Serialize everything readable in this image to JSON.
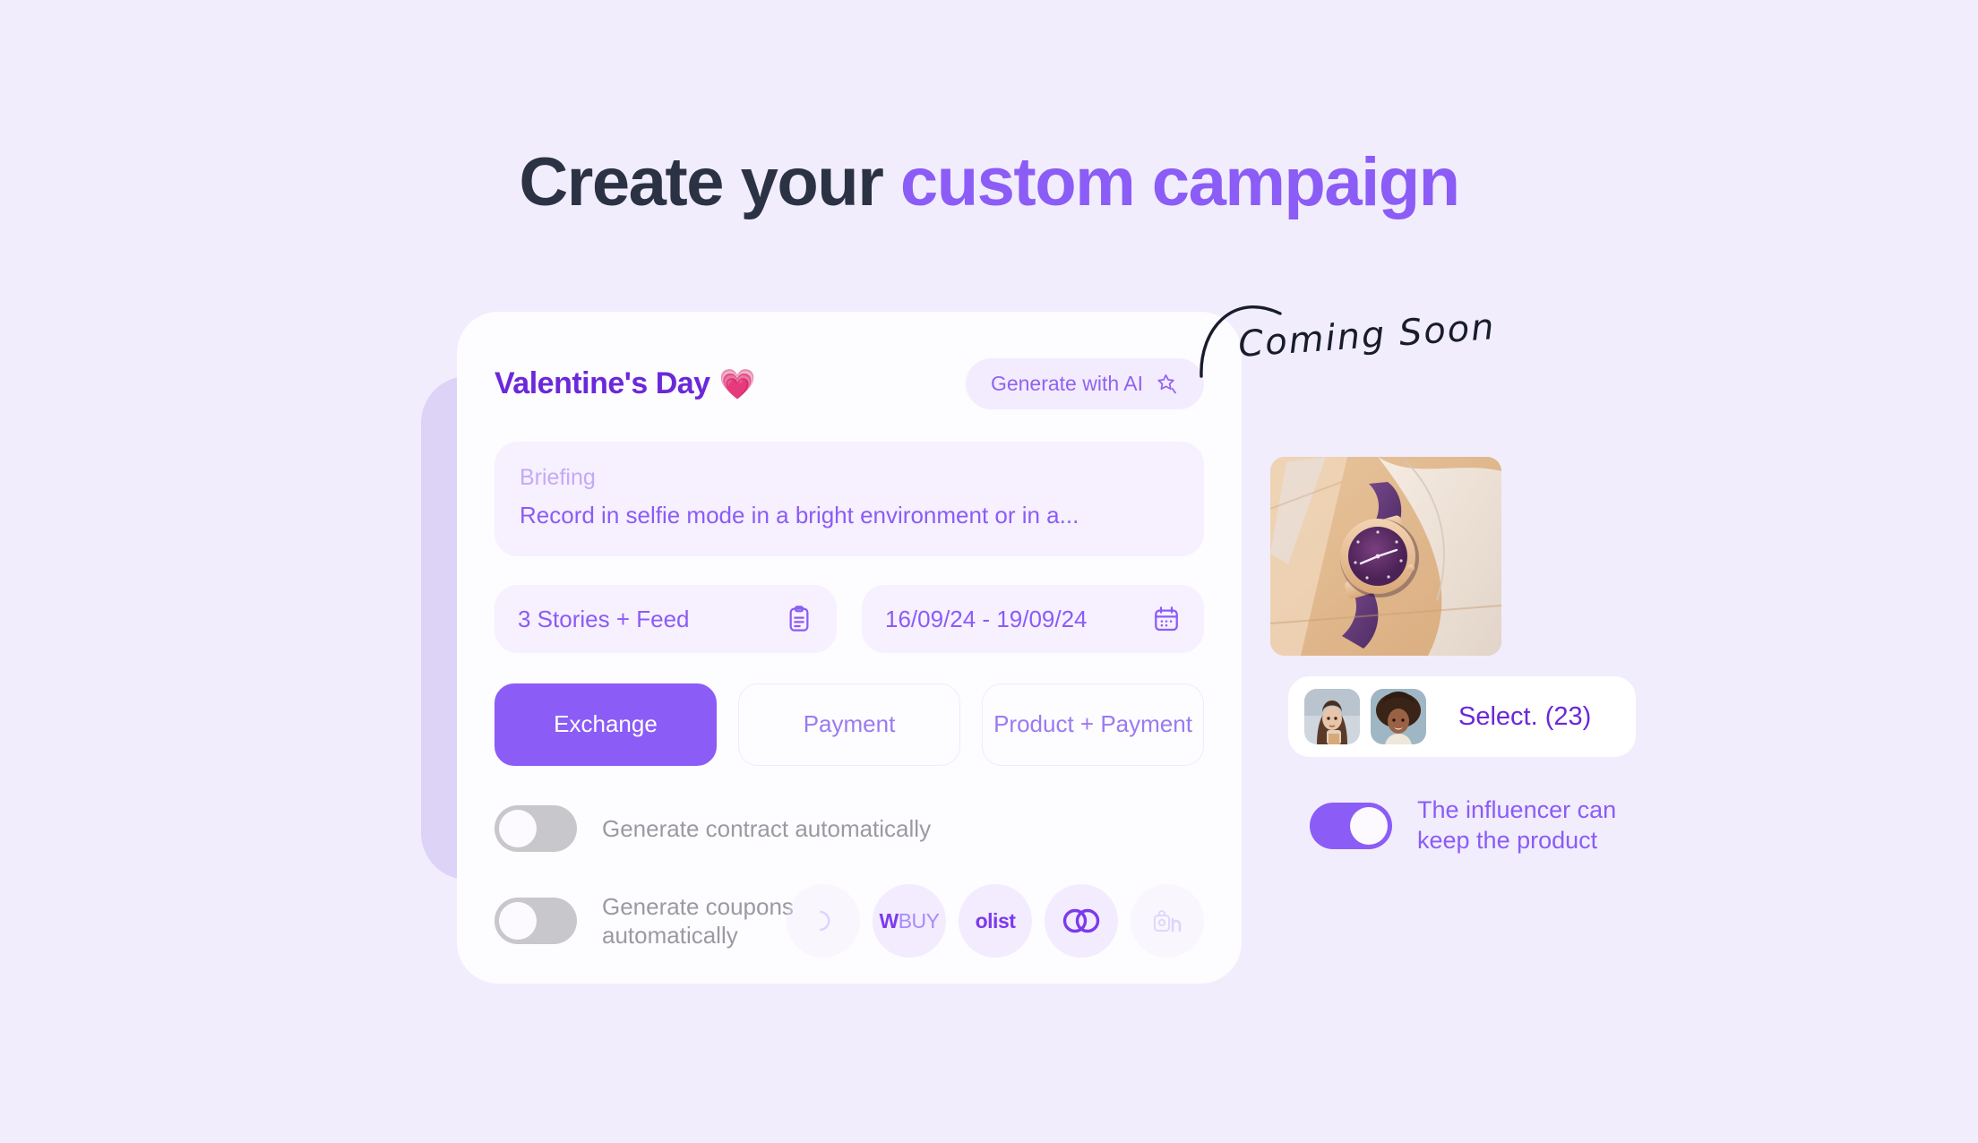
{
  "headline": {
    "lead": "Create your ",
    "accent": "custom campaign"
  },
  "card": {
    "title": "Valentine's Day",
    "title_emoji": "💗",
    "ai_button": {
      "label": "Generate with AI",
      "icon": "sparkle-star-icon"
    },
    "briefing": {
      "label": "Briefing",
      "text": "Record in selfie mode in a bright environment or in a..."
    },
    "fields": [
      {
        "value": "3 Stories + Feed",
        "icon": "clipboard-icon"
      },
      {
        "value": "16/09/24 - 19/09/24",
        "icon": "calendar-icon"
      }
    ],
    "tabs": [
      {
        "label": "Exchange",
        "active": true
      },
      {
        "label": "Payment",
        "active": false
      },
      {
        "label": "Product + Payment",
        "active": false
      }
    ],
    "switches": [
      {
        "label": "Generate contract automatically",
        "on": false
      },
      {
        "label": "Generate coupons automatically",
        "on": false
      }
    ],
    "logos": [
      {
        "name": "partner-logo-faded-left",
        "text": "",
        "faded": true
      },
      {
        "name": "wbuy-logo",
        "text_bold": "W",
        "text_thin": "BUY",
        "faded": false
      },
      {
        "name": "olist-logo",
        "text": "olist",
        "faded": false
      },
      {
        "name": "loop-logo",
        "text": "",
        "faded": false
      },
      {
        "name": "bagy-logo-faded-right",
        "text": "",
        "faded": true
      }
    ]
  },
  "annotation": {
    "coming_soon": "Coming Soon"
  },
  "right_panel": {
    "product_image_alt": "purple-leather-wristwatch",
    "select": {
      "label": "Select. (23)",
      "avatars": [
        "influencer-avatar-1",
        "influencer-avatar-2"
      ]
    },
    "keep_product": {
      "label": "The influencer can keep the product",
      "line1": "The influencer can",
      "line2": "keep the product",
      "on": true
    }
  },
  "colors": {
    "background": "#f1edfd",
    "accent": "#8b5cf6",
    "accent_dark": "#6b28d9",
    "heading": "#2b3244",
    "card": "#fdfcff",
    "field_bg": "#f6f0ff",
    "switch_off": "#c7c7cc"
  }
}
